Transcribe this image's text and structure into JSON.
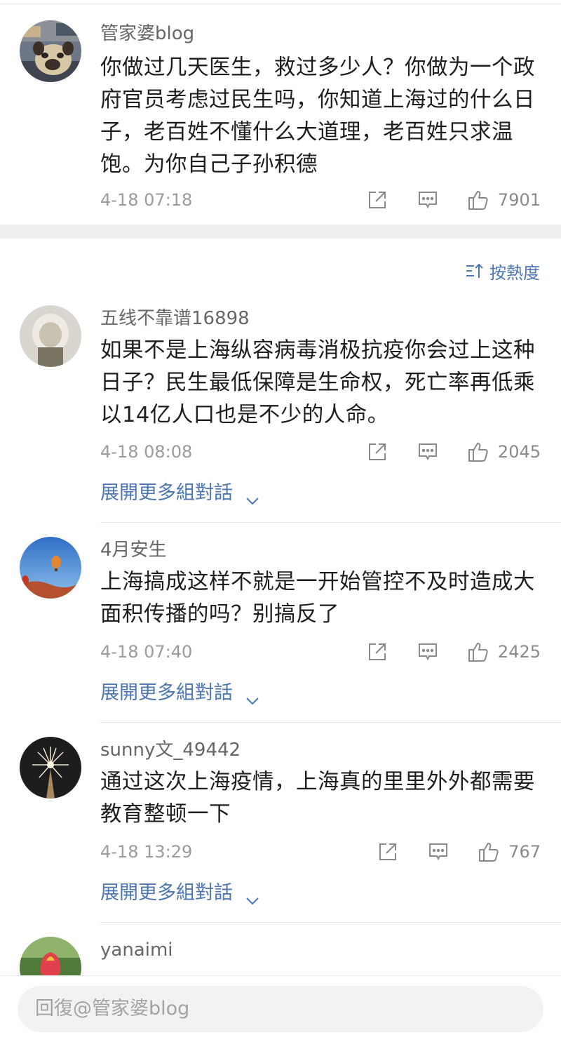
{
  "main_comment": {
    "author": "管家婆blog",
    "lines": [
      "你做过几天医生，救过多少人？你做为一个政",
      "府官员考虑过民生吗，你知道上海过的什么日",
      "子，老百姓不懂什么大道理，老百姓只求温",
      "饱。为你自己子孙积德"
    ],
    "time": "4-18 07:18",
    "likes": "7901",
    "avatar_icon": "pug-dog-avatar"
  },
  "sort": {
    "label": "按熱度",
    "icon": "sort-hot-icon"
  },
  "replies": [
    {
      "author": "五线不靠谱16898",
      "lines": [
        "如果不是上海纵容病毒消极抗疫你会过上这种",
        "日子？民生最低保障是生命权，死亡率再低乘",
        "以14亿人口也是不少的人命。"
      ],
      "time": "4-18 08:08",
      "likes": "2045",
      "expand_label": "展開更多組對話",
      "avatar_icon": "cartoon-avatar"
    },
    {
      "author": "4月安生",
      "lines": [
        "上海搞成这样不就是一开始管控不及时造成大",
        "面积传播的吗？别搞反了"
      ],
      "time": "4-18 07:40",
      "likes": "2425",
      "expand_label": "展開更多組對話",
      "avatar_icon": "hot-air-balloon-avatar"
    },
    {
      "author": "sunny文_49442",
      "lines": [
        "通过这次上海疫情，上海真的里里外外都需要",
        "教育整顿一下"
      ],
      "time": "4-18 13:29",
      "likes": "767",
      "expand_label": "展開更多組對話",
      "avatar_icon": "fireworks-avatar"
    },
    {
      "author": "yanaimi",
      "lines": [],
      "avatar_icon": "tulip-avatar"
    }
  ],
  "reply_input": {
    "placeholder": "回復@管家婆blog"
  },
  "colors": {
    "link": "#4c77b3",
    "band": "#efefef",
    "muted": "#9b9b9b"
  }
}
